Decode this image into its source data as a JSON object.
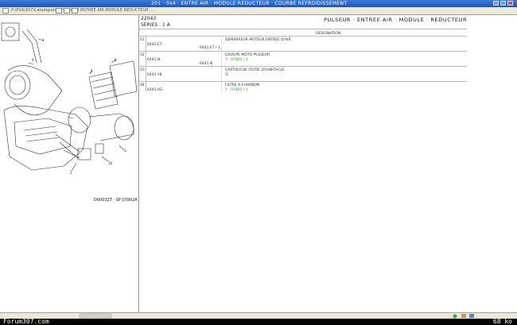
{
  "window": {
    "title": "201 · 0x4 · ENTRE AIR · MODULE REDUCTEUR · COURBE REFROIDISSEMENT"
  },
  "toolbar": {
    "path": "P:\\PSA\\307\\Catalogue\\... PULSEUR ENTREE AIR MODULE REDUCTEUR ..."
  },
  "figure": {
    "caption": "D00032T · SP 07802A",
    "callouts": [
      "1",
      "2",
      "4",
      "5",
      "6",
      "10",
      "3"
    ]
  },
  "header": {
    "code": "22043",
    "model": "SERIES : 1  A",
    "title": "PULSEUR · ENTREE AIR · MODULE · REDUCTEUR",
    "column_label": "DESIGNATION"
  },
  "rows": [
    {
      "num": "01",
      "ref": "6441.E7",
      "desc": "DEMARREUR MOTEUR ENTREE D'AIR",
      "sub": "",
      "sub2": "6441.E7 / 1"
    },
    {
      "num": "02",
      "ref": "6441.N",
      "desc": "GROUPE MOTO PULSEUR",
      "sub": "Y : 07802 / 1",
      "sub2": "6441.N"
    },
    {
      "num": "03",
      "ref": "6441.Y8",
      "desc": "CARTOUCHE FILTRE D'HABITACLE",
      "sub": "",
      "sub2": "/1"
    },
    {
      "num": "04",
      "ref": "6441.AG",
      "desc": "FILTRE A CHARBON",
      "sub": "Y : 07802 / 1",
      "sub2": ""
    }
  ],
  "taskbar": {
    "forum": "Forum307.com",
    "size": "68 ko"
  }
}
